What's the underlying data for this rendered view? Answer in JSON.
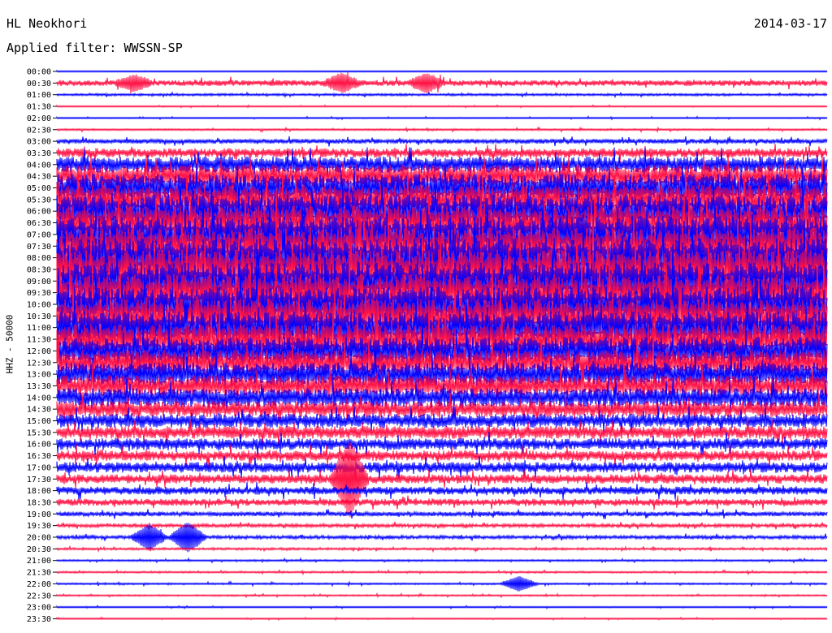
{
  "header": {
    "station": "HL Neokhori",
    "date": "2014-03-17",
    "filter_text": "Applied filter: WWSSN-SP"
  },
  "chart_data": {
    "type": "line",
    "title": "HL Neokhori",
    "subtitle": "Applied filter: WWSSN-SP",
    "date": "2014-03-17",
    "ylabel": "HHZ - 50000",
    "xlabel": "",
    "rows": [
      "00:00",
      "00:30",
      "01:00",
      "01:30",
      "02:00",
      "02:30",
      "03:00",
      "03:30",
      "04:00",
      "04:30",
      "05:00",
      "05:30",
      "06:00",
      "06:30",
      "07:00",
      "07:30",
      "08:00",
      "08:30",
      "09:00",
      "09:30",
      "10:00",
      "10:30",
      "11:00",
      "11:30",
      "12:00",
      "12:30",
      "13:00",
      "13:30",
      "14:00",
      "14:30",
      "15:00",
      "15:30",
      "16:00",
      "16:30",
      "17:00",
      "17:30",
      "18:00",
      "18:30",
      "19:00",
      "19:30",
      "20:00",
      "20:30",
      "21:00",
      "21:30",
      "22:00",
      "22:30",
      "23:00",
      "23:30"
    ],
    "row_colors": [
      "#0000ff",
      "#ff1144"
    ],
    "row_duration_minutes": 30,
    "relative_amplitude": [
      0.03,
      0.25,
      0.1,
      0.05,
      0.06,
      0.08,
      0.2,
      0.4,
      0.7,
      1.0,
      1.2,
      1.3,
      1.4,
      1.5,
      1.6,
      1.6,
      1.7,
      1.7,
      1.6,
      1.6,
      1.5,
      1.5,
      1.4,
      1.3,
      1.2,
      1.1,
      1.0,
      0.9,
      0.8,
      0.7,
      0.6,
      0.55,
      0.5,
      0.45,
      0.45,
      0.4,
      0.35,
      0.3,
      0.2,
      0.15,
      0.15,
      0.1,
      0.08,
      0.08,
      0.08,
      0.07,
      0.06,
      0.05
    ],
    "events": [
      {
        "row": "00:30",
        "time_fraction": 0.1,
        "amplitude": 0.6
      },
      {
        "row": "00:30",
        "time_fraction": 0.37,
        "amplitude": 0.7
      },
      {
        "row": "00:30",
        "time_fraction": 0.48,
        "amplitude": 0.7
      },
      {
        "row": "17:30",
        "time_fraction": 0.38,
        "amplitude": 3.0
      },
      {
        "row": "20:00",
        "time_fraction": 0.12,
        "amplitude": 1.0
      },
      {
        "row": "20:00",
        "time_fraction": 0.17,
        "amplitude": 1.2
      },
      {
        "row": "22:00",
        "time_fraction": 0.6,
        "amplitude": 0.6
      }
    ]
  }
}
